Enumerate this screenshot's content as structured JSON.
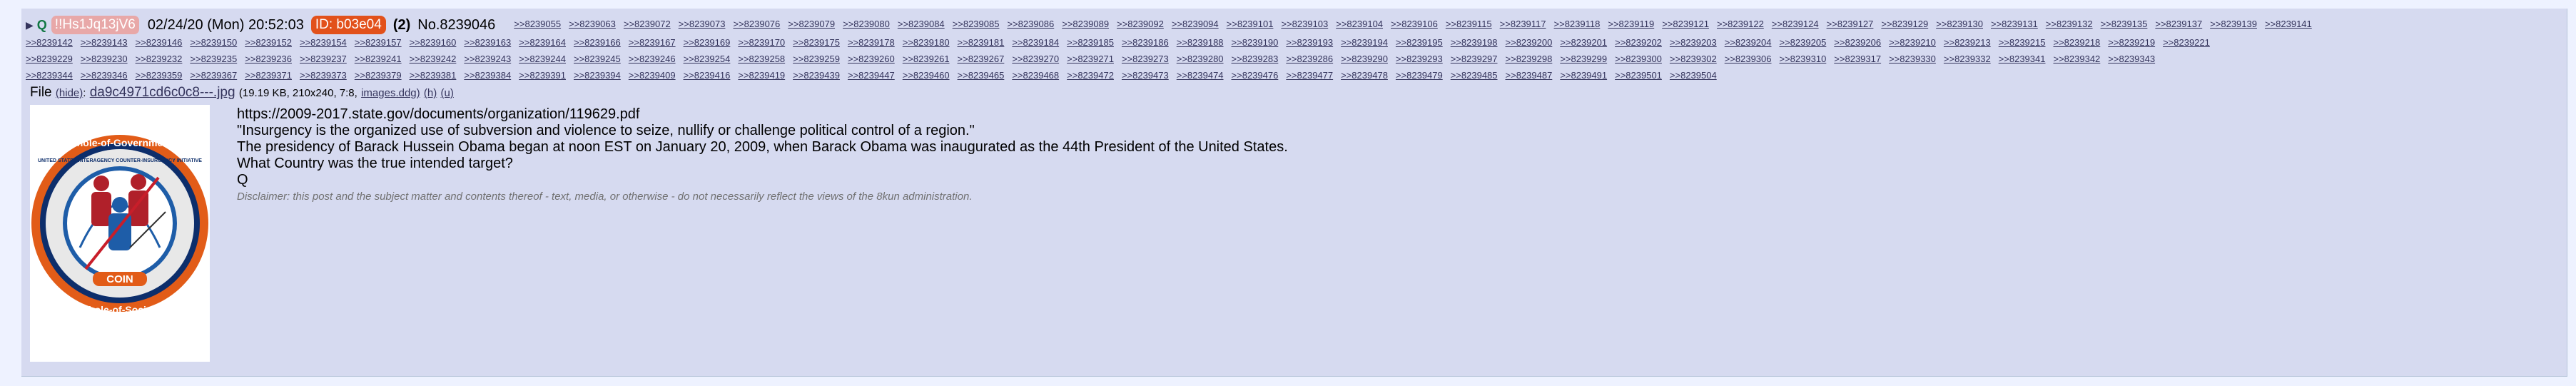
{
  "post": {
    "tripcode": "!!Hs1Jq13jV6",
    "date": "02/24/20 (Mon) 20:52:03",
    "id_label": "ID: b03e04",
    "post_count": "(2)",
    "no_label": "No.",
    "number": "8239046",
    "replies_line1": [
      ">>8239055",
      ">>8239063",
      ">>8239072",
      ">>8239073",
      ">>8239076",
      ">>8239079",
      ">>8239080",
      ">>8239084",
      ">>8239085",
      ">>8239086",
      ">>8239089",
      ">>8239092",
      ">>8239094",
      ">>8239101",
      ">>8239103",
      ">>8239104",
      ">>8239106",
      ">>8239115",
      ">>8239117",
      ">>8239118",
      ">>8239119",
      ">>8239121",
      ">>8239122",
      ">>8239124",
      ">>8239127",
      ">>8239129",
      ">>8239130",
      ">>8239131",
      ">>8239132",
      ">>8239135",
      ">>8239137",
      ">>8239139",
      ">>8239141"
    ],
    "replies_line2": [
      ">>8239142",
      ">>8239143",
      ">>8239146",
      ">>8239150",
      ">>8239152",
      ">>8239154",
      ">>8239157",
      ">>8239160",
      ">>8239163",
      ">>8239164",
      ">>8239166",
      ">>8239167",
      ">>8239169",
      ">>8239170",
      ">>8239175",
      ">>8239178",
      ">>8239180",
      ">>8239181",
      ">>8239184",
      ">>8239185",
      ">>8239186",
      ">>8239188",
      ">>8239190",
      ">>8239193",
      ">>8239194",
      ">>8239195",
      ">>8239198",
      ">>8239200",
      ">>8239201",
      ">>8239202",
      ">>8239203",
      ">>8239204",
      ">>8239205",
      ">>8239206",
      ">>8239210",
      ">>8239213",
      ">>8239215",
      ">>8239218",
      ">>8239219",
      ">>8239221"
    ],
    "replies_line3": [
      ">>8239229",
      ">>8239230",
      ">>8239232",
      ">>8239235",
      ">>8239236",
      ">>8239237",
      ">>8239241",
      ">>8239242",
      ">>8239243",
      ">>8239244",
      ">>8239245",
      ">>8239246",
      ">>8239254",
      ">>8239258",
      ">>8239259",
      ">>8239260",
      ">>8239261",
      ">>8239267",
      ">>8239270",
      ">>8239271",
      ">>8239273",
      ">>8239280",
      ">>8239283",
      ">>8239286",
      ">>8239290",
      ">>8239293",
      ">>8239297",
      ">>8239298",
      ">>8239299",
      ">>8239300",
      ">>8239302",
      ">>8239306",
      ">>8239310",
      ">>8239317",
      ">>8239330",
      ">>8239332",
      ">>8239341",
      ">>8239342",
      ">>8239343"
    ],
    "replies_line4": [
      ">>8239344",
      ">>8239346",
      ">>8239359",
      ">>8239367",
      ">>8239371",
      ">>8239373",
      ">>8239379",
      ">>8239381",
      ">>8239384",
      ">>8239391",
      ">>8239394",
      ">>8239409",
      ">>8239416",
      ">>8239419",
      ">>8239439",
      ">>8239447",
      ">>8239460",
      ">>8239465",
      ">>8239468",
      ">>8239472",
      ">>8239473",
      ">>8239474",
      ">>8239476",
      ">>8239477",
      ">>8239478",
      ">>8239479",
      ">>8239485",
      ">>8239487",
      ">>8239491",
      ">>8239501",
      ">>8239504"
    ]
  },
  "file": {
    "label": "File",
    "hide": "(hide)",
    "name": "da9c4971cd6c0c8---.jpg",
    "meta": "(19.19 KB, 210x240, 7:8,",
    "images": "images.ddg)",
    "h": "(h)",
    "u": "(u)"
  },
  "logo": {
    "top_text": "Whole-of-Government",
    "ring_text": "UNITED STATES INTERAGENCY COUNTER-INSURGENCY INITIATIVE",
    "center": "COIN",
    "bottom_text": "Whole-of-Society"
  },
  "body": {
    "line1": "https://2009-2017.state.gov/documents/organization/119629.pdf",
    "line2": "\"Insurgency is the organized use of subversion and violence to seize, nullify or challenge political control of a region.\"",
    "line3": "The presidency of Barack Hussein Obama began at noon EST on January 20, 2009, when Barack Obama was inaugurated as the 44th President of the United States.",
    "line4": "What Country was the true intended target?",
    "line5": "Q",
    "disclaimer": "Disclaimer: this post and the subject matter and contents thereof - text, media, or otherwise - do not necessarily reflect the views of the 8kun administration."
  }
}
